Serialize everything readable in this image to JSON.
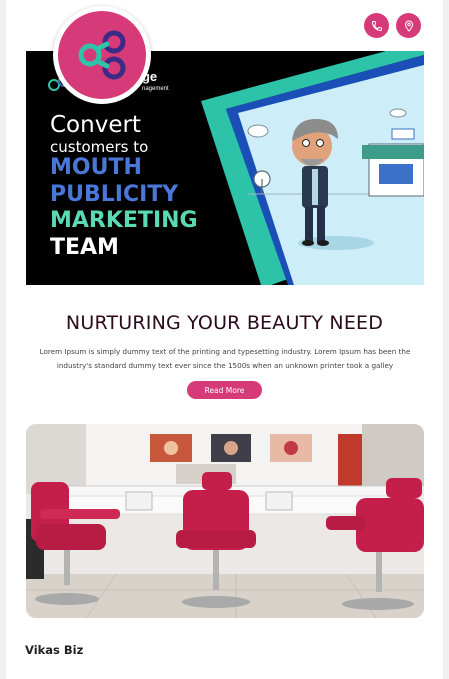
{
  "colors": {
    "accent": "#d63a78",
    "headline": "#2b0a1a",
    "banner_bg": "#000000"
  },
  "header": {
    "logo_icon": "infinity-link-logo",
    "actions": [
      {
        "name": "phone-icon"
      },
      {
        "name": "location-pin-icon"
      }
    ]
  },
  "banner": {
    "brand_name": "nge",
    "brand_sub": "nagement",
    "line1": "Convert",
    "line2": "customers to",
    "line3": "MOUTH",
    "line4": "PUBLICITY",
    "line5": "MARKETING",
    "line6": "TEAM"
  },
  "content": {
    "headline": "NURTURING YOUR BEAUTY NEED",
    "description": "Lorem Ipsum is simply dummy text of the printing and typesetting industry. Lorem Ipsum has been the industry's standard dummy text ever since the 1500s when an unknown printer took a galley",
    "read_more_label": "Read More"
  },
  "footer": {
    "brand": "Vikas Biz"
  }
}
